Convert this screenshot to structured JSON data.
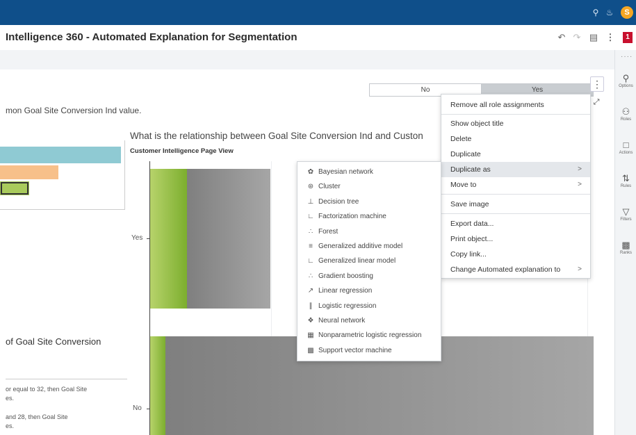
{
  "header": {
    "search_icon": "search-icon",
    "notification_icon": "bell-icon",
    "user_initial": "S"
  },
  "titlebar": {
    "title": "Intelligence 360 - Automated Explanation for Segmentation",
    "badge": "1"
  },
  "canvas": {
    "subtext": "mon Goal Site Conversion Ind value.",
    "section_title": "of Goal Site Conversion",
    "rules": [
      "or equal to 32, then Goal Site",
      "es.",
      "and 28, then Goal Site",
      "es."
    ]
  },
  "toggle": {
    "no": "No",
    "yes": "Yes"
  },
  "chart": {
    "title": "What is the relationship between Goal Site Conversion Ind and Custon",
    "subtitle": "Customer Intelligence Page View"
  },
  "chart_data": {
    "type": "bar",
    "orientation": "horizontal",
    "stacked": true,
    "categories": [
      "Yes",
      "No"
    ],
    "title": "What is the relationship between Goal Site Conversion Ind and Custon",
    "subtitle": "Customer Intelligence Page View",
    "colors": [
      "#9ac547",
      "#8c8c8c"
    ],
    "grid": true
  },
  "menu": {
    "items": [
      {
        "label": "Remove all role assignments",
        "arrow": ""
      },
      {
        "label": "Show object title",
        "arrow": ""
      },
      {
        "label": "Delete",
        "arrow": ""
      },
      {
        "label": "Duplicate",
        "arrow": ""
      },
      {
        "label": "Duplicate as",
        "arrow": ">"
      },
      {
        "label": "Move to",
        "arrow": ">"
      },
      {
        "label": "Save image",
        "arrow": ""
      },
      {
        "label": "Export data...",
        "arrow": ""
      },
      {
        "label": "Print object...",
        "arrow": ""
      },
      {
        "label": "Copy link...",
        "arrow": ""
      },
      {
        "label": "Change Automated explanation to",
        "arrow": ">"
      }
    ]
  },
  "submenu": {
    "items": [
      {
        "label": "Bayesian network",
        "icon": "bayesian-network-icon"
      },
      {
        "label": "Cluster",
        "icon": "cluster-icon"
      },
      {
        "label": "Decision tree",
        "icon": "decision-tree-icon"
      },
      {
        "label": "Factorization machine",
        "icon": "factorization-machine-icon"
      },
      {
        "label": "Forest",
        "icon": "forest-icon"
      },
      {
        "label": "Generalized additive model",
        "icon": "generalized-additive-model-icon"
      },
      {
        "label": "Generalized linear model",
        "icon": "generalized-linear-model-icon"
      },
      {
        "label": "Gradient boosting",
        "icon": "gradient-boosting-icon"
      },
      {
        "label": "Linear regression",
        "icon": "linear-regression-icon"
      },
      {
        "label": "Logistic regression",
        "icon": "logistic-regression-icon"
      },
      {
        "label": "Neural network",
        "icon": "neural-network-icon"
      },
      {
        "label": "Nonparametric logistic regression",
        "icon": "nonparametric-logistic-regression-icon"
      },
      {
        "label": "Support vector machine",
        "icon": "support-vector-machine-icon"
      }
    ]
  },
  "right_panel": {
    "items": [
      {
        "label": "Options",
        "icon": "options-icon"
      },
      {
        "label": "Roles",
        "icon": "roles-icon"
      },
      {
        "label": "Actions",
        "icon": "actions-icon"
      },
      {
        "label": "Rules",
        "icon": "rules-icon"
      },
      {
        "label": "Filters",
        "icon": "filter-icon"
      },
      {
        "label": "Ranks",
        "icon": "ranks-icon"
      }
    ]
  }
}
